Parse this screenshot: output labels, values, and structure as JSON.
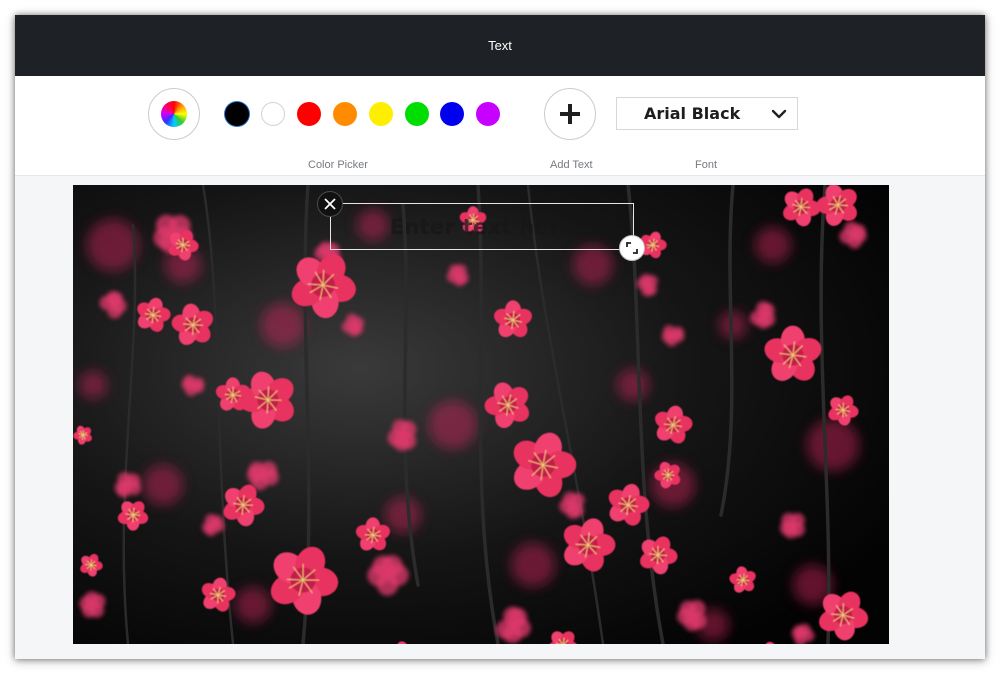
{
  "titlebar": {
    "title": "Text"
  },
  "toolbar": {
    "color_picker_label": "Color Picker",
    "add_text_label": "Add Text",
    "font_label": "Font",
    "font_value": "Arial Black",
    "swatches": [
      {
        "name": "black",
        "color": "#000000"
      },
      {
        "name": "white",
        "color": "#ffffff"
      },
      {
        "name": "red",
        "color": "#ff0000"
      },
      {
        "name": "orange",
        "color": "#ff8c00"
      },
      {
        "name": "yellow",
        "color": "#ffee00"
      },
      {
        "name": "green",
        "color": "#00dd00"
      },
      {
        "name": "blue",
        "color": "#0000ee"
      },
      {
        "name": "purple",
        "color": "#c800ff"
      }
    ]
  },
  "canvas": {
    "text_placeholder": "Enter text here",
    "image_subject": "pink plum blossoms on dark background"
  },
  "icons": {
    "color_wheel": "color-wheel-icon",
    "add": "plus-icon",
    "dropdown": "chevron-down-icon",
    "close": "close-icon",
    "resize": "resize-icon"
  }
}
